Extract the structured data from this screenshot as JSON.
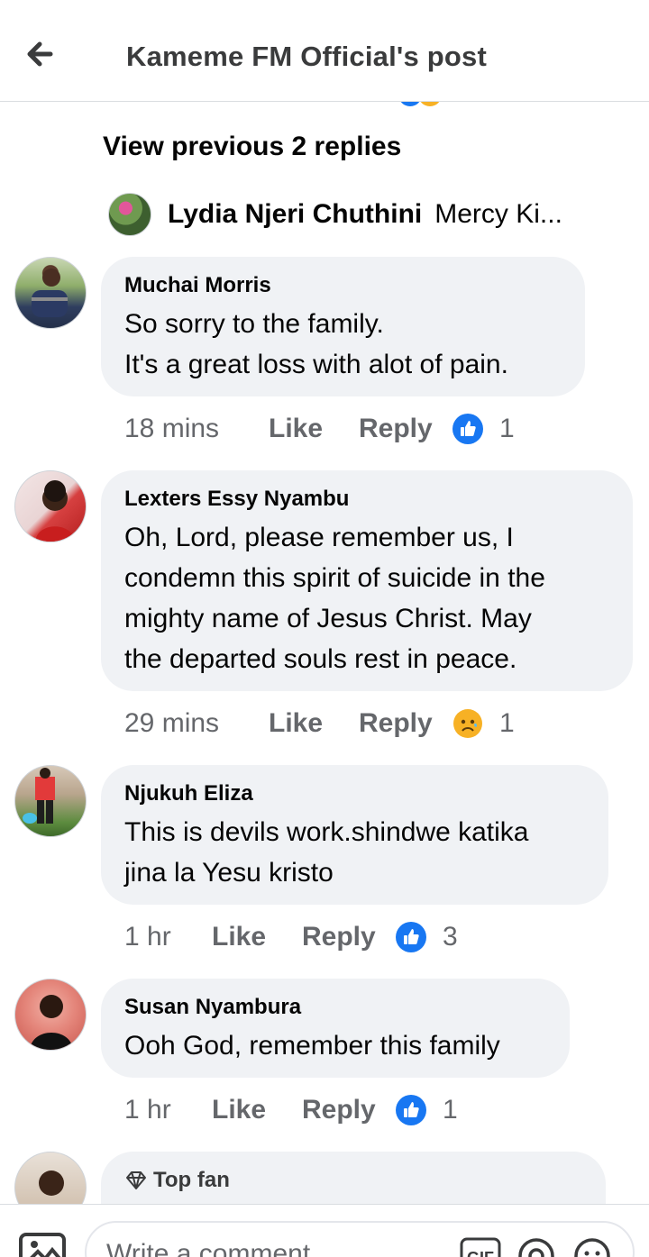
{
  "header": {
    "title": "Kameme FM Official's post"
  },
  "thread": {
    "view_previous": "View previous 2 replies",
    "reply_preview": {
      "name": "Lydia Njeri Chuthini",
      "snippet": "Mercy Ki..."
    }
  },
  "comments": [
    {
      "author": "Muchai Morris",
      "lines": [
        "So sorry to the family.",
        "It's a great loss with alot of pain."
      ],
      "time": "18 mins",
      "like": "Like",
      "reply": "Reply",
      "reaction": "like-icon",
      "reaction_count": "1"
    },
    {
      "author": "Lexters Essy Nyambu",
      "lines": [
        "Oh, Lord, please remember us, I",
        "condemn this spirit of suicide in the",
        "mighty name of Jesus Christ. May",
        "the departed souls rest in peace."
      ],
      "time": "29 mins",
      "like": "Like",
      "reply": "Reply",
      "reaction": "sad-icon",
      "reaction_count": "1"
    },
    {
      "author": "Njukuh Eliza",
      "lines": [
        "This is devils work.shindwe katika",
        "jina la Yesu kristo"
      ],
      "time": "1 hr",
      "like": "Like",
      "reply": "Reply",
      "reaction": "like-icon",
      "reaction_count": "3"
    },
    {
      "author": "Susan Nyambura",
      "lines": [
        "Ooh God, remember this family"
      ],
      "time": "1 hr",
      "like": "Like",
      "reply": "Reply",
      "reaction": "like-icon",
      "reaction_count": "1"
    },
    {
      "badge": "Top fan"
    }
  ],
  "composer": {
    "placeholder": "Write a comment",
    "gif_label": "GIF"
  },
  "colors": {
    "like_blue": "#1877f2",
    "bubble": "#f0f2f5",
    "muted": "#65676b",
    "sad_yellow": "#f7b125"
  }
}
